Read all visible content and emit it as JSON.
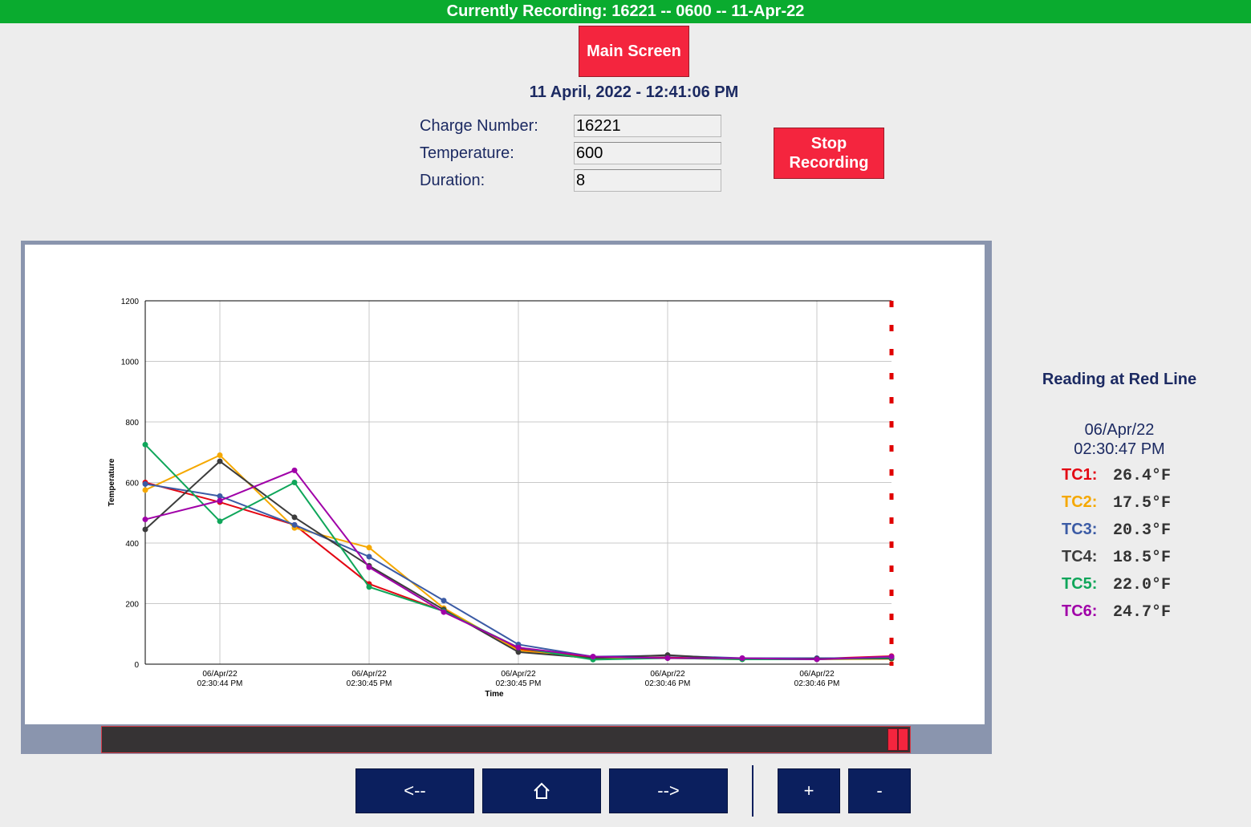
{
  "header": {
    "recording_text": "Currently Recording: 16221 -- 0600 -- 11-Apr-22"
  },
  "buttons": {
    "main_screen": "Main Screen",
    "stop_recording": "Stop\nRecording"
  },
  "datetime": "11 April, 2022 - 12:41:06 PM",
  "form": {
    "charge_number": {
      "label": "Charge Number:",
      "value": "16221"
    },
    "temperature": {
      "label": "Temperature:",
      "value": "600"
    },
    "duration": {
      "label": "Duration:",
      "value": "8"
    }
  },
  "readout": {
    "title": "Reading at Red Line",
    "date": "06/Apr/22",
    "time": "02:30:47 PM",
    "items": [
      {
        "label": "TC1:",
        "value": "26.4°F",
        "color": "#e30613"
      },
      {
        "label": "TC2:",
        "value": "17.5°F",
        "color": "#f5a800"
      },
      {
        "label": "TC3:",
        "value": "20.3°F",
        "color": "#3b5ba5"
      },
      {
        "label": "TC4:",
        "value": "18.5°F",
        "color": "#3c3c3c"
      },
      {
        "label": "TC5:",
        "value": "22.0°F",
        "color": "#0fa65a"
      },
      {
        "label": "TC6:",
        "value": "24.7°F",
        "color": "#a000a8"
      }
    ]
  },
  "nav": {
    "back": "<--",
    "home_icon": "home-icon",
    "forward": "-->",
    "zoom_in": "+",
    "zoom_out": "-"
  },
  "scrollbar": {
    "position": 1.0
  },
  "chart_data": {
    "type": "line",
    "xlabel": "Time",
    "ylabel": "Temperature",
    "ylim": [
      0,
      1200
    ],
    "yticks": [
      0,
      200,
      400,
      600,
      800,
      1000,
      1200
    ],
    "xticks": [
      {
        "x": 0.5,
        "date": "06/Apr/22",
        "time": "02:30:44 PM"
      },
      {
        "x": 1.5,
        "date": "06/Apr/22",
        "time": "02:30:45 PM"
      },
      {
        "x": 2.5,
        "date": "06/Apr/22",
        "time": "02:30:45 PM"
      },
      {
        "x": 3.5,
        "date": "06/Apr/22",
        "time": "02:30:46 PM"
      },
      {
        "x": 4.5,
        "date": "06/Apr/22",
        "time": "02:30:46 PM"
      }
    ],
    "xlim": [
      0,
      5
    ],
    "grid": true,
    "red_line_x": 5,
    "x": [
      0,
      0.5,
      1,
      1.5,
      2,
      2.5,
      3,
      3.5,
      4,
      4.5,
      5
    ],
    "series": [
      {
        "name": "TC1",
        "color": "#e30613",
        "values": [
          600,
          535,
          460,
          265,
          175,
          50,
          22,
          22,
          18,
          18,
          26.4
        ]
      },
      {
        "name": "TC2",
        "color": "#f5a800",
        "values": [
          575,
          690,
          450,
          385,
          185,
          45,
          18,
          20,
          16,
          16,
          17.5
        ]
      },
      {
        "name": "TC3",
        "color": "#3b5ba5",
        "values": [
          595,
          555,
          460,
          355,
          210,
          65,
          25,
          28,
          20,
          20,
          20.3
        ]
      },
      {
        "name": "TC4",
        "color": "#3c3c3c",
        "values": [
          445,
          670,
          485,
          325,
          180,
          40,
          20,
          30,
          16,
          18,
          18.5
        ]
      },
      {
        "name": "TC5",
        "color": "#0fa65a",
        "values": [
          725,
          472,
          600,
          255,
          175,
          55,
          15,
          20,
          16,
          16,
          22.0
        ]
      },
      {
        "name": "TC6",
        "color": "#a000a8",
        "values": [
          478,
          540,
          640,
          320,
          172,
          55,
          25,
          20,
          20,
          16,
          24.7
        ]
      }
    ]
  }
}
